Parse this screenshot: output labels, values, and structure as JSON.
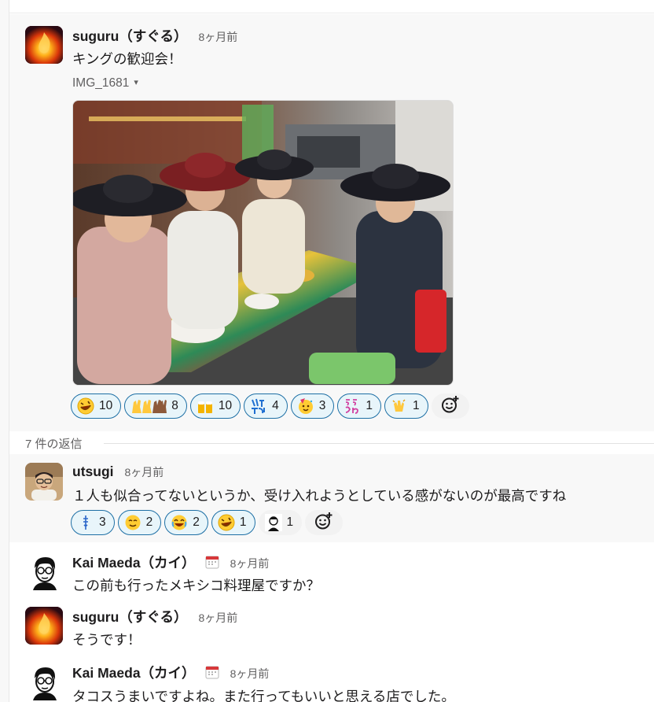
{
  "thread": {
    "replies_label": "7 件の返信"
  },
  "parent": {
    "author": "suguru（すぐる）",
    "time": "8ヶ月前",
    "text": "キングの歓迎会！",
    "file": {
      "name": "IMG_1681",
      "caret": "▾"
    },
    "reactions": [
      {
        "emoji": "rofl-emoji",
        "count": "10"
      },
      {
        "emoji": "raised-hands-emoji",
        "count": "8"
      },
      {
        "emoji": "beers-emoji",
        "count": "10"
      },
      {
        "emoji": "iine-text-emoji",
        "count": "4"
      },
      {
        "emoji": "partying-face-emoji",
        "count": "3"
      },
      {
        "emoji": "eeyan-text-emoji",
        "count": "1"
      },
      {
        "emoji": "clap-emoji",
        "count": "1"
      }
    ]
  },
  "replies": [
    {
      "author": "utsugi",
      "time": "8ヶ月前",
      "text": "１人も似合ってないというか、受け入れようとしている感がないのが最高ですね",
      "reactions": [
        {
          "emoji": "custom-text-emoji",
          "count": "3"
        },
        {
          "emoji": "relieved-face-emoji",
          "count": "2"
        },
        {
          "emoji": "joy-emoji",
          "count": "2"
        },
        {
          "emoji": "rofl-emoji",
          "count": "1"
        },
        {
          "emoji": "person-avatar-emoji",
          "count": "1"
        }
      ]
    },
    {
      "author": "Kai Maeda（カイ）",
      "time": "8ヶ月前",
      "text": "この前も行ったメキシコ料理屋ですか？"
    },
    {
      "author": "suguru（すぐる）",
      "time": "8ヶ月前",
      "text": "そうです！"
    },
    {
      "author": "Kai Maeda（カイ）",
      "time": "8ヶ月前",
      "text": "タコスうまいですよね。また行ってもいいと思える店でした。"
    }
  ],
  "colors": {
    "reaction_border": "#1d6fa5",
    "reaction_bg": "#e8f5fa",
    "highlight_bg": "#f8f8f8"
  }
}
